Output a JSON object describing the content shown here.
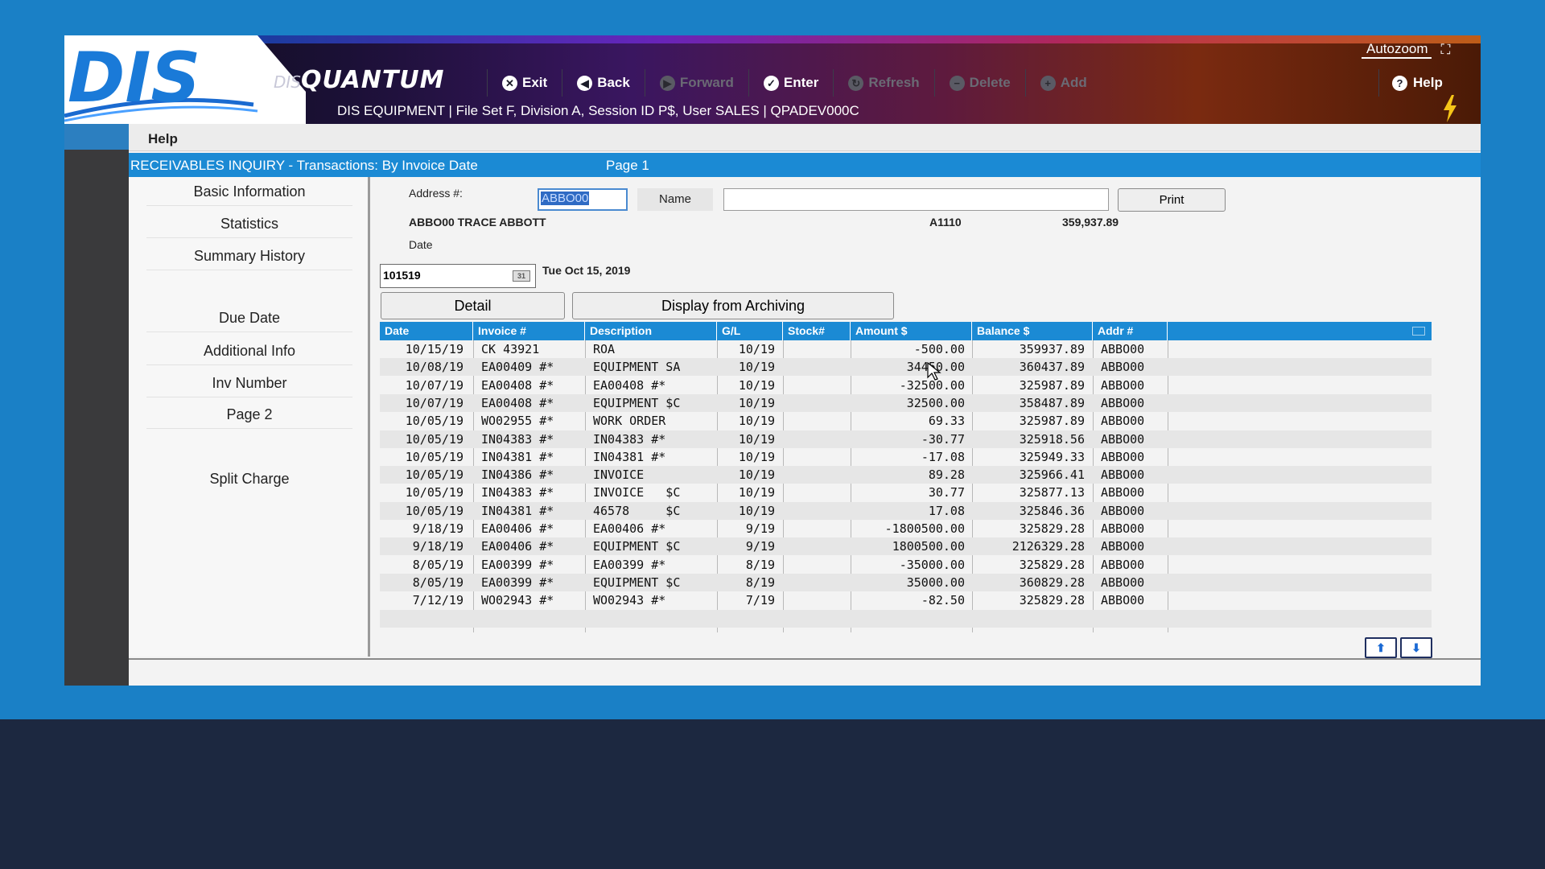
{
  "header": {
    "brand": "DIS",
    "product_prefix": "DIS",
    "product_name": "QUANTUM",
    "session_line": "DIS EQUIPMENT | File Set F, Division A, Session ID P$, User SALES | QPADEV000C",
    "autozoom_label": "Autozoom"
  },
  "toolbar": {
    "exit": "Exit",
    "back": "Back",
    "forward": "Forward",
    "enter": "Enter",
    "refresh": "Refresh",
    "delete": "Delete",
    "add": "Add",
    "help": "Help"
  },
  "menu": {
    "help": "Help"
  },
  "title_bar": {
    "title": "RECEIVABLES INQUIRY - Transactions: By Invoice Date",
    "page": "Page 1"
  },
  "sidebar": {
    "items": [
      "Basic Information",
      "Statistics",
      "Summary History",
      "Due Date",
      "Additional Info",
      "Inv Number",
      "Page 2",
      "Split Charge"
    ]
  },
  "form": {
    "address_label": "Address #:",
    "address_value": "ABBO00",
    "name_button": "Name",
    "name_value": "",
    "print_button": "Print",
    "customer_line": "ABBO00 TRACE ABBOTT",
    "account": "A1110",
    "balance": "359,937.89",
    "date_label": "Date",
    "date_value": "101519",
    "date_display": "Tue Oct 15, 2019",
    "detail_button": "Detail",
    "archive_button": "Display from Archiving"
  },
  "grid": {
    "columns": [
      "Date",
      "Invoice #",
      "Description",
      "G/L",
      "Stock#",
      "Amount $",
      "Balance $",
      "Addr #"
    ],
    "rows": [
      [
        "10/15/19",
        "CK 43921",
        "ROA",
        "10/19",
        "",
        "-500.00",
        "359937.89",
        "ABBO00"
      ],
      [
        "10/08/19",
        "EA00409 #*",
        "EQUIPMENT SA",
        "10/19",
        "",
        "34450.00",
        "360437.89",
        "ABBO00"
      ],
      [
        "10/07/19",
        "EA00408 #*",
        "EA00408 #*",
        "10/19",
        "",
        "-32500.00",
        "325987.89",
        "ABBO00"
      ],
      [
        "10/07/19",
        "EA00408 #*",
        "EQUIPMENT $C",
        "10/19",
        "",
        "32500.00",
        "358487.89",
        "ABBO00"
      ],
      [
        "10/05/19",
        "WO02955 #*",
        "WORK ORDER",
        "10/19",
        "",
        "69.33",
        "325987.89",
        "ABBO00"
      ],
      [
        "10/05/19",
        "IN04383 #*",
        "IN04383 #*",
        "10/19",
        "",
        "-30.77",
        "325918.56",
        "ABBO00"
      ],
      [
        "10/05/19",
        "IN04381 #*",
        "IN04381 #*",
        "10/19",
        "",
        "-17.08",
        "325949.33",
        "ABBO00"
      ],
      [
        "10/05/19",
        "IN04386 #*",
        "INVOICE",
        "10/19",
        "",
        "89.28",
        "325966.41",
        "ABBO00"
      ],
      [
        "10/05/19",
        "IN04383 #*",
        "INVOICE   $C",
        "10/19",
        "",
        "30.77",
        "325877.13",
        "ABBO00"
      ],
      [
        "10/05/19",
        "IN04381 #*",
        "46578     $C",
        "10/19",
        "",
        "17.08",
        "325846.36",
        "ABBO00"
      ],
      [
        "9/18/19",
        "EA00406 #*",
        "EA00406 #*",
        "9/19",
        "",
        "-1800500.00",
        "325829.28",
        "ABBO00"
      ],
      [
        "9/18/19",
        "EA00406 #*",
        "EQUIPMENT $C",
        "9/19",
        "",
        "1800500.00",
        "2126329.28",
        "ABBO00"
      ],
      [
        "8/05/19",
        "EA00399 #*",
        "EA00399 #*",
        "8/19",
        "",
        "-35000.00",
        "325829.28",
        "ABBO00"
      ],
      [
        "8/05/19",
        "EA00399 #*",
        "EQUIPMENT $C",
        "8/19",
        "",
        "35000.00",
        "360829.28",
        "ABBO00"
      ],
      [
        "7/12/19",
        "WO02943 #*",
        "WO02943 #*",
        "7/19",
        "",
        "-82.50",
        "325829.28",
        "ABBO00"
      ]
    ]
  },
  "colors": {
    "accent": "#1b8ad4",
    "background_band": "#1a80c6",
    "footer_band": "#1c2840"
  }
}
